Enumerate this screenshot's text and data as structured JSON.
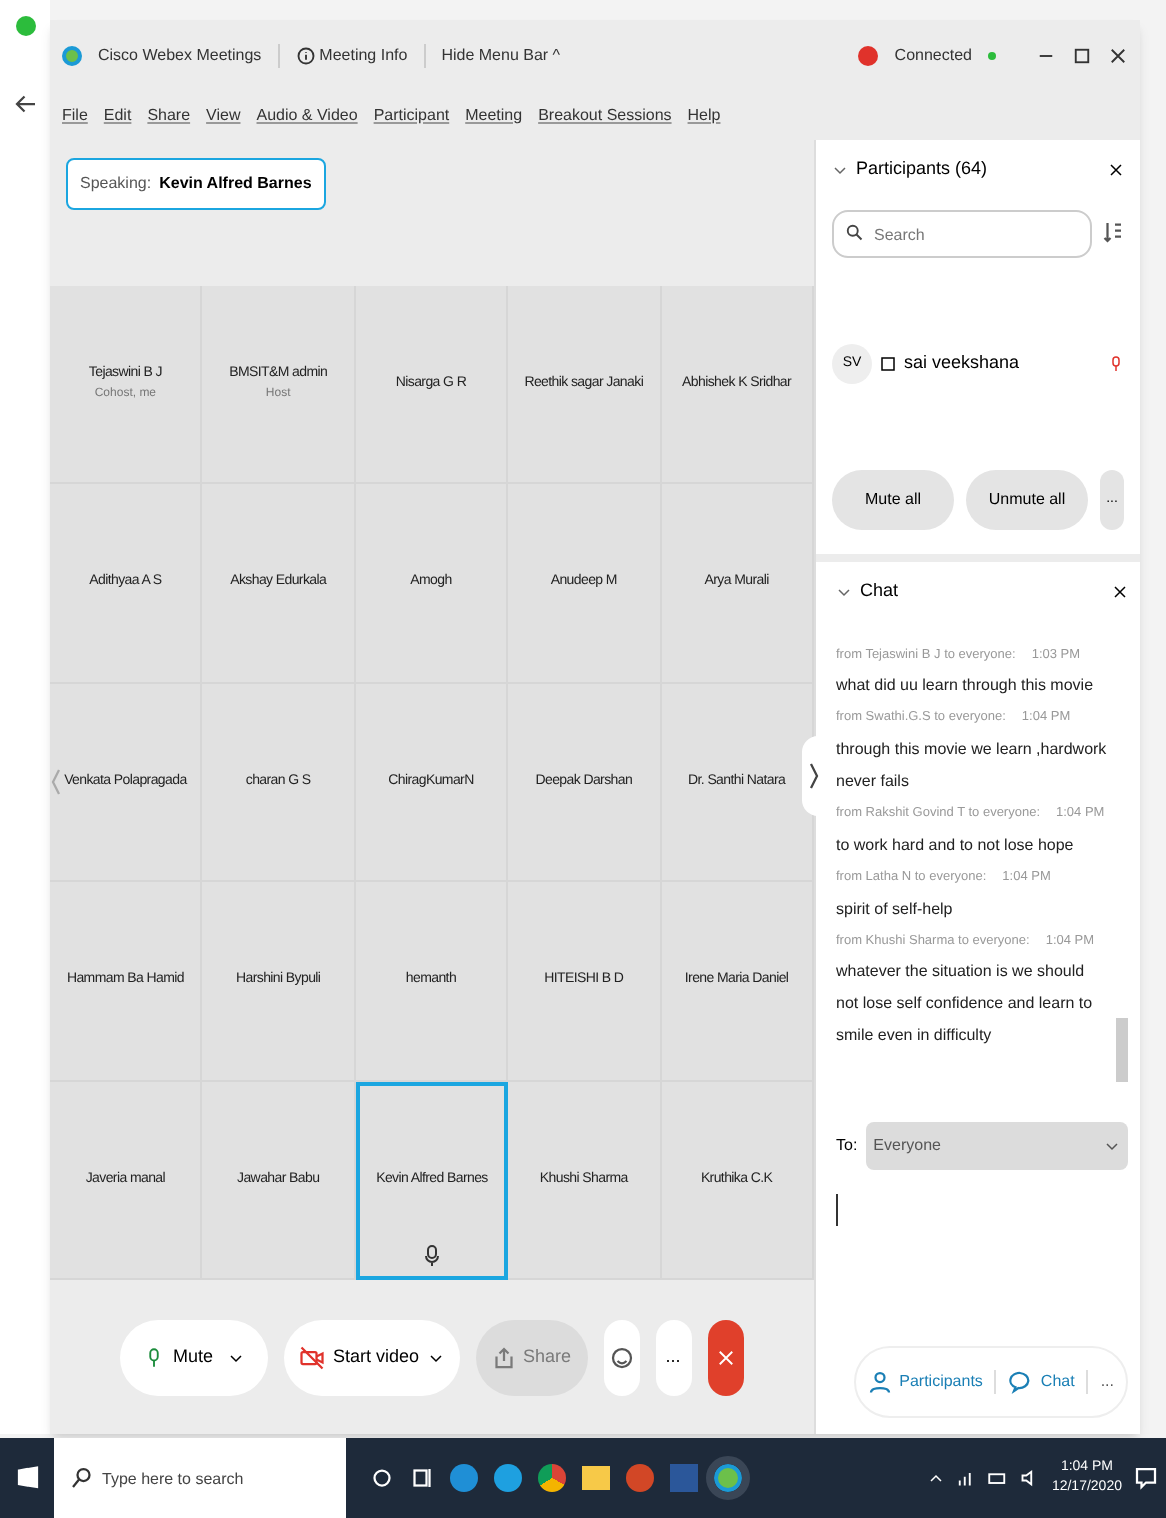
{
  "window": {
    "app_title": "Cisco Webex Meetings",
    "meeting_info": "Meeting Info",
    "hide_menu": "Hide Menu Bar ^",
    "status": "Connected",
    "menu": [
      "File",
      "Edit",
      "Share",
      "View",
      "Audio & Video",
      "Participant",
      "Meeting",
      "Breakout Sessions",
      "Help"
    ]
  },
  "speaking": {
    "label": "Speaking:",
    "name": "Kevin Alfred Barnes"
  },
  "tiles": [
    {
      "name": "Tejaswini B J",
      "role": "Cohost, me",
      "selected": false,
      "mic": false
    },
    {
      "name": "BMSIT&M admin",
      "role": "Host",
      "selected": false,
      "mic": false
    },
    {
      "name": "Nisarga G R",
      "selected": false,
      "mic": false
    },
    {
      "name": "Reethik sagar Janaki",
      "selected": false,
      "mic": false
    },
    {
      "name": "Abhishek K Sridhar",
      "selected": false,
      "mic": false
    },
    {
      "name": "Adithyaa A S",
      "selected": false,
      "mic": false
    },
    {
      "name": "Akshay Edurkala",
      "selected": false,
      "mic": false
    },
    {
      "name": "Amogh",
      "selected": false,
      "mic": false
    },
    {
      "name": "Anudeep M",
      "selected": false,
      "mic": false
    },
    {
      "name": "Arya Murali",
      "selected": false,
      "mic": false
    },
    {
      "name": "Venkata Polapragada",
      "selected": false,
      "mic": false
    },
    {
      "name": "charan G S",
      "selected": false,
      "mic": false
    },
    {
      "name": "ChiragKumarN",
      "selected": false,
      "mic": false
    },
    {
      "name": "Deepak Darshan",
      "selected": false,
      "mic": false
    },
    {
      "name": "Dr. Santhi Natara",
      "selected": false,
      "mic": false
    },
    {
      "name": "Hammam Ba Hamid",
      "selected": false,
      "mic": false
    },
    {
      "name": "Harshini Bypuli",
      "selected": false,
      "mic": false
    },
    {
      "name": "hemanth",
      "selected": false,
      "mic": false
    },
    {
      "name": "HITEISHI B D",
      "selected": false,
      "mic": false
    },
    {
      "name": "Irene Maria Daniel",
      "selected": false,
      "mic": false
    },
    {
      "name": "Javeria manal",
      "selected": false,
      "mic": false
    },
    {
      "name": "Jawahar Babu",
      "selected": false,
      "mic": false
    },
    {
      "name": "Kevin Alfred Barnes",
      "selected": true,
      "mic": true
    },
    {
      "name": "Khushi Sharma",
      "selected": false,
      "mic": false
    },
    {
      "name": "Kruthika C.K",
      "selected": false,
      "mic": false
    }
  ],
  "participants": {
    "title": "Participants (64)",
    "search_placeholder": "Search",
    "rows": [
      {
        "initials": "SV",
        "name": "sai veekshana",
        "muted": true
      }
    ],
    "mute_all": "Mute all",
    "unmute_all": "Unmute all",
    "more": "..."
  },
  "chat": {
    "title": "Chat",
    "messages": [
      {
        "from": "from Tejaswini B J to everyone:",
        "time": "1:03 PM",
        "text": "what did uu learn through this movie"
      },
      {
        "from": "from Swathi.G.S to everyone:",
        "time": "1:04 PM",
        "text": "through this movie we learn ,hardwork never fails"
      },
      {
        "from": "from Rakshit Govind T to everyone:",
        "time": "1:04 PM",
        "text": "to work hard and to not lose hope"
      },
      {
        "from": "from Latha N to everyone:",
        "time": "1:04 PM",
        "text": "spirit of self-help"
      },
      {
        "from": "from Khushi Sharma to everyone:",
        "time": "1:04 PM",
        "text": "whatever the situation is we should not lose self confidence and learn to smile even in difficulty"
      }
    ],
    "to_label": "To:",
    "to_value": "Everyone"
  },
  "controls": {
    "mute": "Mute",
    "video": "Start video",
    "share": "Share",
    "share_disabled": true,
    "more": "...",
    "participants": "Participants",
    "chat": "Chat",
    "more_right": "..."
  },
  "taskbar": {
    "search_placeholder": "Type here to search",
    "time": "1:04 PM",
    "date": "12/17/2020"
  }
}
